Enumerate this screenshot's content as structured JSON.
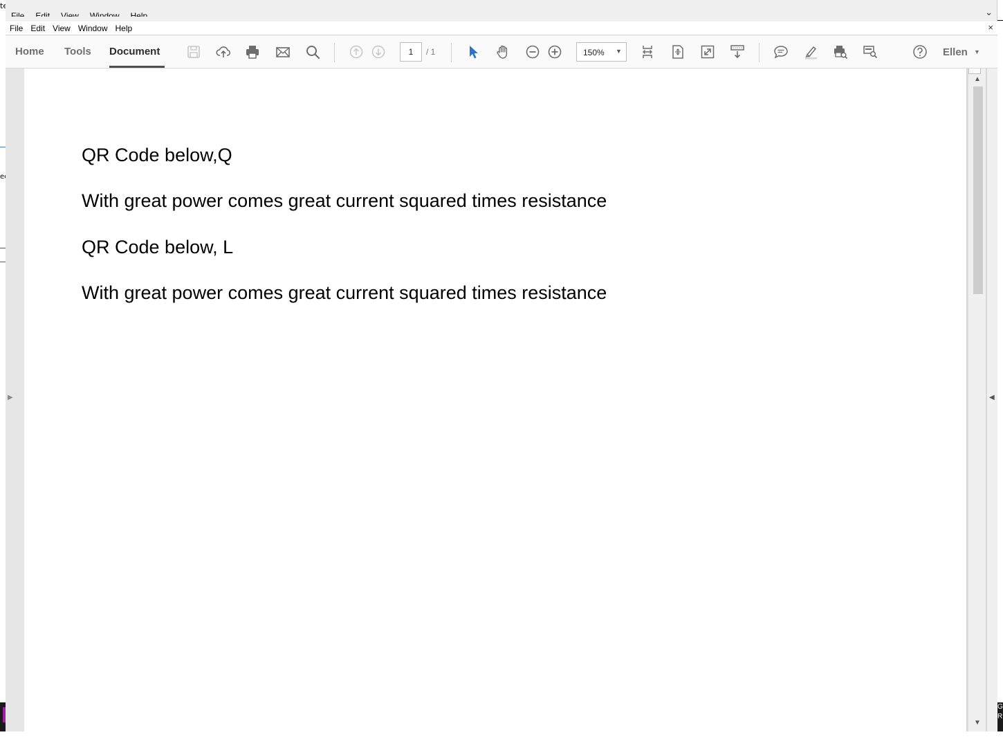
{
  "ghost_menu": [
    "File",
    "Edit",
    "View",
    "Window",
    "Help"
  ],
  "background": {
    "left_top_text": "te",
    "left_mid_text": "ec",
    "right_bottom_text": "G R"
  },
  "menubar": {
    "items": [
      "File",
      "Edit",
      "View",
      "Window",
      "Help"
    ]
  },
  "window_controls": {
    "chevron": "⌄",
    "close": "×"
  },
  "toolbar": {
    "tabs": [
      "Home",
      "Tools",
      "Document"
    ],
    "active_tab": "Document",
    "page_current": "1",
    "page_total": "/ 1",
    "zoom": "150%",
    "user": "Ellen",
    "accent_color": "#2d73c9"
  },
  "document": {
    "lines": [
      "QR Code below,Q",
      "With great power comes great current squared times resistance",
      "QR Code below, L",
      "With great power comes great current squared times resistance"
    ]
  }
}
